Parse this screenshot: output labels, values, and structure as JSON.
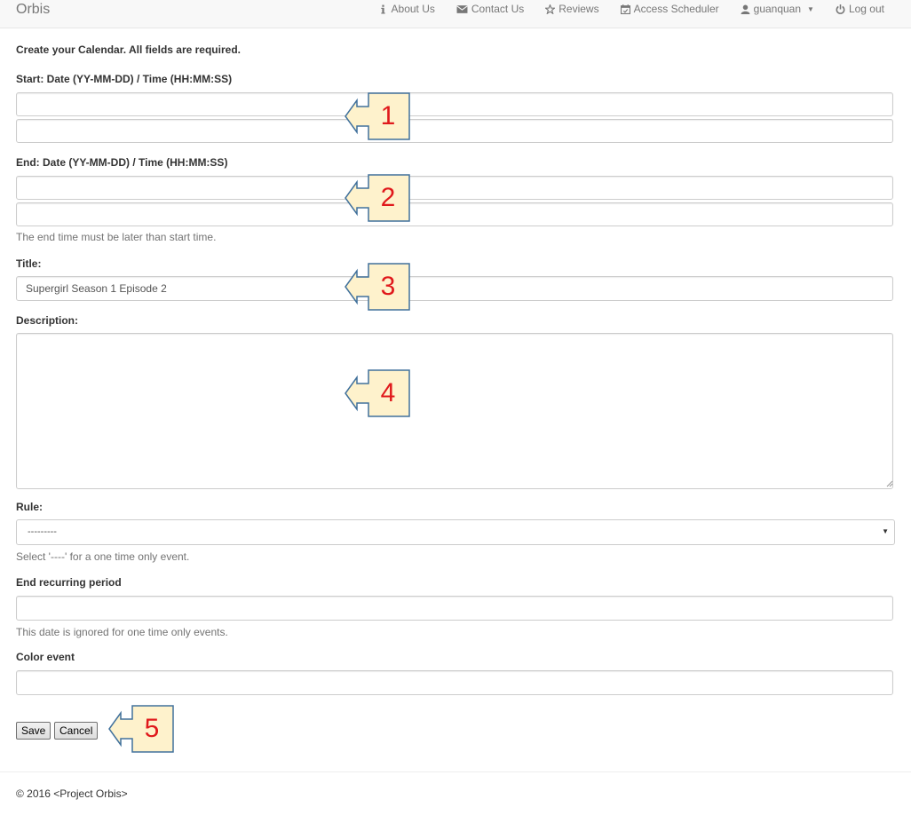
{
  "nav": {
    "brand": "Orbis",
    "items": [
      {
        "label": "About Us",
        "icon": "info-icon"
      },
      {
        "label": "Contact Us",
        "icon": "envelope-icon"
      },
      {
        "label": "Reviews",
        "icon": "star-icon"
      },
      {
        "label": "Access Scheduler",
        "icon": "calendar-icon"
      },
      {
        "label": "guanquan",
        "icon": "user-icon"
      },
      {
        "label": "Log out",
        "icon": "power-icon"
      }
    ]
  },
  "form": {
    "heading": "Create your Calendar. All fields are required.",
    "start_label": "Start: Date (YY-MM-DD) / Time (HH:MM:SS)",
    "start_date_value": "",
    "start_time_value": "",
    "end_label": "End: Date (YY-MM-DD) / Time (HH:MM:SS)",
    "end_date_value": "",
    "end_time_value": "",
    "end_help": "The end time must be later than start time.",
    "title_label": "Title:",
    "title_value": "Supergirl Season 1 Episode 2",
    "description_label": "Description:",
    "description_value": "",
    "rule_label": "Rule:",
    "rule_selected": "---------",
    "rule_help": "Select '----' for a one time only event.",
    "end_recurring_label": "End recurring period",
    "end_recurring_value": "",
    "end_recurring_help": "This date is ignored for one time only events.",
    "color_label": "Color event",
    "color_value": "",
    "save_label": "Save",
    "cancel_label": "Cancel"
  },
  "callouts": [
    "1",
    "2",
    "3",
    "4",
    "5"
  ],
  "colors": {
    "callout_fill": "#fef2cc",
    "callout_stroke": "#41719c",
    "callout_number": "#e0191c"
  },
  "footer": {
    "text": "© 2016 <Project Orbis>"
  }
}
